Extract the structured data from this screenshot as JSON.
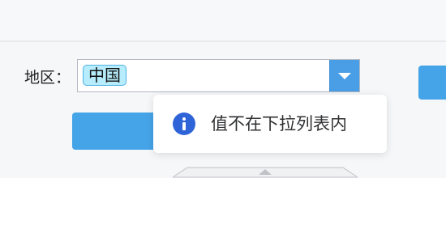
{
  "form": {
    "region_label": "地区：",
    "selected_tags": [
      "中国"
    ]
  },
  "toast": {
    "icon": "info-icon",
    "message": "值不在下拉列表内"
  },
  "colors": {
    "accent": "#45a4e8",
    "info_icon": "#2f64d8",
    "tag_bg": "#b6ecfb"
  }
}
